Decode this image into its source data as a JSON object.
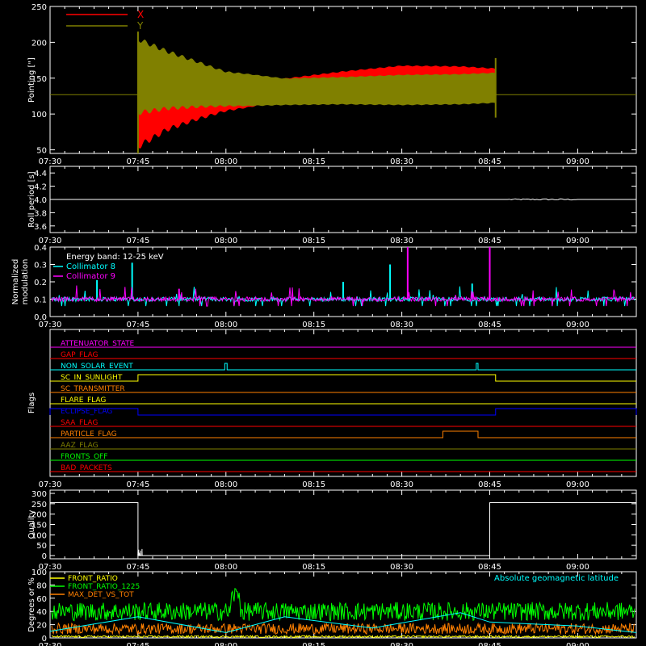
{
  "x_ticks": [
    "07:30",
    "07:45",
    "08:00",
    "08:15",
    "08:30",
    "08:45",
    "09:00"
  ],
  "colors": {
    "axis": "#ffffff",
    "red": "#ff0000",
    "olive": "#808000",
    "white": "#ffffff",
    "cyan": "#00ffff",
    "magenta": "#ff00ff",
    "green": "#00ff00",
    "orange": "#ff8000",
    "yellow": "#ffff00"
  },
  "chart_data": [
    {
      "type": "area",
      "ylabel": "Pointing [\"]",
      "ylim": [
        45,
        250
      ],
      "y_ticks": [
        50,
        100,
        150,
        200,
        250
      ],
      "legend": [
        "X",
        "Y"
      ],
      "legend_placement": "top-left",
      "baseline_value": 127,
      "active_range": [
        "07:45",
        "08:46"
      ],
      "series": [
        {
          "name": "X",
          "color": "red",
          "x": [
            "07:45",
            "07:50",
            "07:55",
            "08:00",
            "08:10",
            "08:20",
            "08:30",
            "08:40",
            "08:46"
          ],
          "low": [
            50,
            75,
            90,
            103,
            118,
            125,
            128,
            130,
            132
          ],
          "high": [
            208,
            185,
            170,
            155,
            150,
            160,
            168,
            167,
            164
          ]
        },
        {
          "name": "Y",
          "color": "olive",
          "x": [
            "07:45",
            "07:50",
            "07:55",
            "08:00",
            "08:10",
            "08:20",
            "08:30",
            "08:40",
            "08:46"
          ],
          "low": [
            98,
            105,
            108,
            110,
            112,
            113,
            112,
            113,
            115
          ],
          "high": [
            208,
            190,
            175,
            160,
            150,
            152,
            155,
            156,
            158
          ]
        }
      ]
    },
    {
      "type": "line",
      "ylabel": "Roll period [s]",
      "ylim": [
        3.5,
        4.5
      ],
      "y_ticks": [
        "3.6",
        "3.8",
        "4.0",
        "4.2",
        "4.4"
      ],
      "x_range": [
        "07:30",
        "09:10"
      ],
      "value": 4.0
    },
    {
      "type": "line",
      "ylabel": "Normalized modulation",
      "ylim": [
        0,
        0.4
      ],
      "y_ticks": [
        "0.0",
        "0.1",
        "0.2",
        "0.3",
        "0.4"
      ],
      "annotation": "Energy band: 12-25 keV",
      "series": [
        {
          "name": "Collimator 8",
          "color": "cyan",
          "base": 0.1,
          "spikes_x": [
            "07:44",
            "08:28",
            "08:42",
            "08:20",
            "07:38"
          ],
          "spikes_y": [
            0.31,
            0.3,
            0.19,
            0.2,
            0.21
          ]
        },
        {
          "name": "Collimator 9",
          "color": "magenta",
          "base": 0.1,
          "spikes_x": [
            "08:31",
            "08:45",
            "07:52"
          ],
          "spikes_y": [
            0.4,
            0.4,
            0.16
          ]
        }
      ]
    },
    {
      "type": "line",
      "ylabel": "Flags",
      "flags": [
        {
          "name": "ATTENUATOR_STATE",
          "color": "magenta",
          "on": []
        },
        {
          "name": "GAP_FLAG",
          "color": "red",
          "on": []
        },
        {
          "name": "NON_SOLAR_EVENT",
          "color": "cyan",
          "on": [
            [
              "07:59.8",
              "08:00.2"
            ],
            [
              "08:42.7",
              "08:43.0"
            ]
          ]
        },
        {
          "name": "SC_IN_SUNLIGHT",
          "color": "yellow",
          "on": [
            [
              "07:45",
              "08:46"
            ]
          ]
        },
        {
          "name": "SC_TRANSMITTER",
          "color": "orange",
          "on": []
        },
        {
          "name": "FLARE_FLAG",
          "color": "yellow",
          "on": []
        },
        {
          "name": "ECLIPSE_FLAG",
          "color": "blue",
          "on": [
            [
              "07:30",
              "07:45"
            ],
            [
              "08:46",
              "09:10"
            ]
          ]
        },
        {
          "name": "SAA_FLAG",
          "color": "red",
          "on": []
        },
        {
          "name": "PARTICLE_FLAG",
          "color": "orange",
          "on": [
            [
              "08:37",
              "08:43"
            ]
          ]
        },
        {
          "name": "AAZ_FLAG",
          "color": "olive",
          "on": []
        },
        {
          "name": "FRONTS_OFF",
          "color": "green",
          "on": []
        },
        {
          "name": "BAD_PACKETS",
          "color": "red",
          "on": []
        }
      ]
    },
    {
      "type": "line",
      "ylabel": "Quality",
      "ylim": [
        0,
        300
      ],
      "y_ticks": [
        0,
        50,
        100,
        150,
        200,
        250,
        300
      ],
      "segments": [
        {
          "x": [
            "07:30",
            "07:45"
          ],
          "value": 255
        },
        {
          "x": [
            "07:45",
            "08:45"
          ],
          "value": 0
        },
        {
          "x": [
            "08:45",
            "09:10"
          ],
          "value": 255
        }
      ]
    },
    {
      "type": "line",
      "ylabel": "Degrees or %",
      "ylim": [
        0,
        100
      ],
      "y_ticks": [
        0,
        20,
        40,
        60,
        80,
        100
      ],
      "legend": [
        "FRONT_RATIO",
        "FRONT_RATIO_1225",
        "MAX_DET_VS_TOT"
      ],
      "annotation": "Absolute geomagnetic latitude",
      "series": [
        {
          "name": "FRONT_RATIO",
          "color": "yellow",
          "mean": 2
        },
        {
          "name": "FRONT_RATIO_1225",
          "color": "green",
          "mean": 40
        },
        {
          "name": "MAX_DET_VS_TOT",
          "color": "orange",
          "mean": 14
        },
        {
          "name": "Absolute geomagnetic latitude",
          "color": "cyan",
          "x": [
            "07:30",
            "07:45",
            "08:00",
            "08:10",
            "08:25",
            "08:40",
            "08:45",
            "09:00",
            "09:10"
          ],
          "y": [
            10,
            32,
            8,
            32,
            15,
            38,
            24,
            18,
            8
          ]
        }
      ]
    }
  ]
}
